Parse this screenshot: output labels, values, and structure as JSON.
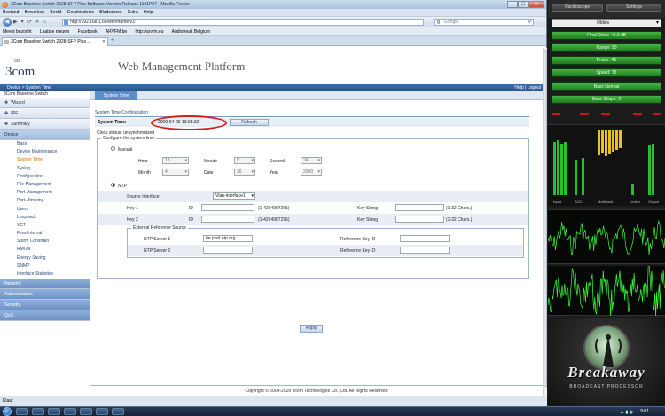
{
  "window": {
    "title": "3Com Baseline Switch 2928-SFP Plus Software Version Release 1101P07 - Mozilla Firefox"
  },
  "menu": [
    "Bestand",
    "Bewerken",
    "Beeld",
    "Geschiedenis",
    "Bladwijzers",
    "Extra",
    "Help"
  ],
  "nav": {
    "url": "http://192.168.1.66/wcn/frame/v.c",
    "search_placeholder": "Google"
  },
  "bookmarks": [
    "Meest bezocht",
    "Laatste nieuws",
    "Facebook",
    "ARVFM.be",
    "http://arvfm.eu",
    "Audiofreak Belgium"
  ],
  "tab": {
    "label": "3Com Baseline Switch 2928-SFP Plus ..."
  },
  "page": {
    "logo": "3com",
    "platform_title": "Web Management Platform",
    "breadcrumb": "Device > System Time",
    "help_logout": "Help | Logout",
    "system_name": "3Com Baseline Switch",
    "sidebar": {
      "top_sections": [
        {
          "label": "Wizard"
        },
        {
          "label": "IRF"
        },
        {
          "label": "Summary"
        }
      ],
      "device_label": "Device",
      "device_items": [
        "Basic",
        "Device Maintenance",
        "System Time",
        "Syslog",
        "Configuration",
        "File Management",
        "Port Management",
        "Port Mirroring",
        "Users",
        "Loopback",
        "VCT",
        "Flow Interval",
        "Storm Constrain",
        "RMON",
        "Energy Saving",
        "SNMP",
        "Interface Statistics"
      ],
      "bottom_sections": [
        "Network",
        "Authentication",
        "Security",
        "QoS"
      ]
    },
    "main_tab": "System Time",
    "config_title": "System Time Configuration",
    "system_time_label": "System Time:",
    "system_time_value": "2000-04-26  13:08:32",
    "refresh_label": "Refresh",
    "clock_status": "Clock status: unsynchronized",
    "configure_legend": "Configure the system time",
    "manual_label": "Manual",
    "hour_label": "Hour",
    "hour_value": "13",
    "minute_label": "Minute",
    "minute_value": "8",
    "second_label": "Second",
    "second_value": "24",
    "month_label": "Month",
    "month_value": "4",
    "date_label": "Date",
    "date_value": "26",
    "year_label": "Year",
    "year_value": "2000",
    "ntp_label": "NTP",
    "source_interface_label": "Source Interface",
    "source_interface_value": "Vlan-interface1",
    "key1_label": "Key 1",
    "key2_label": "Key 2",
    "id_label": "ID",
    "id_range": "(1-4294967295)",
    "key_string_label": "Key String",
    "key_string_range": "(1-32 Chars.)",
    "ext_ref_legend": "External Reference Source",
    "ntp1_label": "NTP Server 1",
    "ntp1_value": "be.pool.ntp.org",
    "ntp2_label": "NTP Server 2",
    "ntp2_value": "",
    "ref_key_id_label": "Reference Key ID",
    "apply_label": "Apply",
    "copyright": "Copyright © 2004-2009 3com Technologies Co., Ltd. All Rights Reserved"
  },
  "statusbar": "Klaar",
  "taskbar": {
    "clock": "9:01"
  },
  "breakaway": {
    "oscilloscope_label": "Oscilloscope",
    "settings_label": "Settings",
    "preset": "Oldies",
    "bars": [
      "Final Drive: +0.0 dB",
      "Range: 50",
      "Power: 41",
      "Speed: 75",
      "Bass Normal",
      "Bass Shape: 0"
    ],
    "meter_labels": [
      "Input",
      "AGC",
      "Multiband",
      "Limiter",
      "Output"
    ],
    "brand": "Breakaway",
    "brand_sub": "BROADCAST PROCESSOR",
    "colors": {
      "green": "#2e9a2e",
      "meter_yellow": "#e8c21a",
      "meter_green": "#29c129",
      "scope": "#3dff3d"
    }
  }
}
